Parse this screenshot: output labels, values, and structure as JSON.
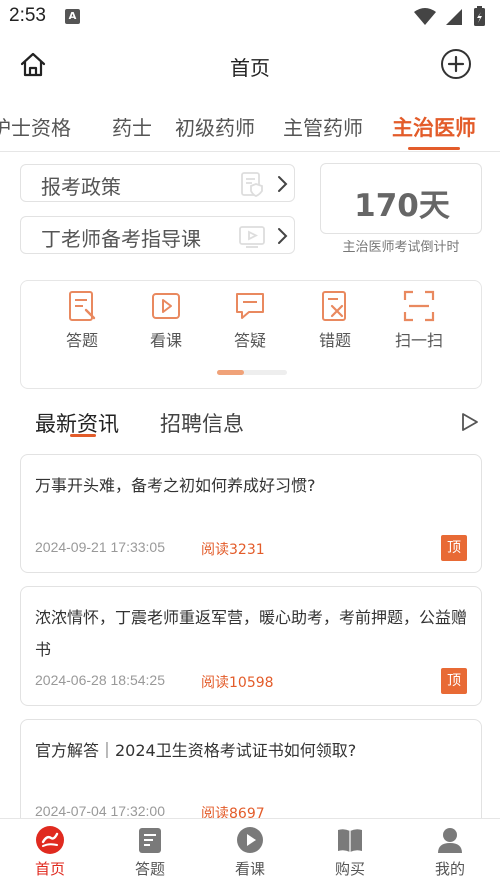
{
  "status_bar": {
    "time": "2:53",
    "notif_icon": "A"
  },
  "header": {
    "title": "首页"
  },
  "tabs": [
    {
      "label": "护士资格"
    },
    {
      "label": "药士"
    },
    {
      "label": "初级药师"
    },
    {
      "label": "主管药师"
    },
    {
      "label": "主治医师"
    }
  ],
  "active_tab": "主治医师",
  "links": [
    {
      "label": "报考政策"
    },
    {
      "label": "丁老师备考指导课"
    }
  ],
  "countdown": {
    "value": "170天",
    "label": "主治医师考试倒计时"
  },
  "features": [
    {
      "label": "答题",
      "icon": "answer-icon"
    },
    {
      "label": "看课",
      "icon": "video-icon"
    },
    {
      "label": "答疑",
      "icon": "chat-icon"
    },
    {
      "label": "错题",
      "icon": "wrong-icon"
    },
    {
      "label": "扫一扫",
      "icon": "scan-icon"
    }
  ],
  "news_tabs": {
    "latest": "最新资讯",
    "jobs": "招聘信息"
  },
  "articles": [
    {
      "title": "万事开头难，备考之初如何养成好习惯?",
      "date": "2024-09-21 17:33:05",
      "reads": "阅读3231",
      "badge": "顶"
    },
    {
      "title": "浓浓情怀，丁震老师重返军营，暖心助考，考前押题，公益赠书",
      "date": "2024-06-28 18:54:25",
      "reads": "阅读10598",
      "badge": "顶"
    },
    {
      "title": "官方解答｜2024卫生资格考试证书如何领取?",
      "date": "2024-07-04 17:32:00",
      "reads": "阅读8697",
      "badge": ""
    }
  ],
  "bottom_nav": [
    {
      "label": "首页",
      "active": true
    },
    {
      "label": "答题"
    },
    {
      "label": "看课"
    },
    {
      "label": "购买"
    },
    {
      "label": "我的"
    }
  ],
  "colors": {
    "accent": "#e35c2a",
    "active_nav": "#e02a1f"
  }
}
